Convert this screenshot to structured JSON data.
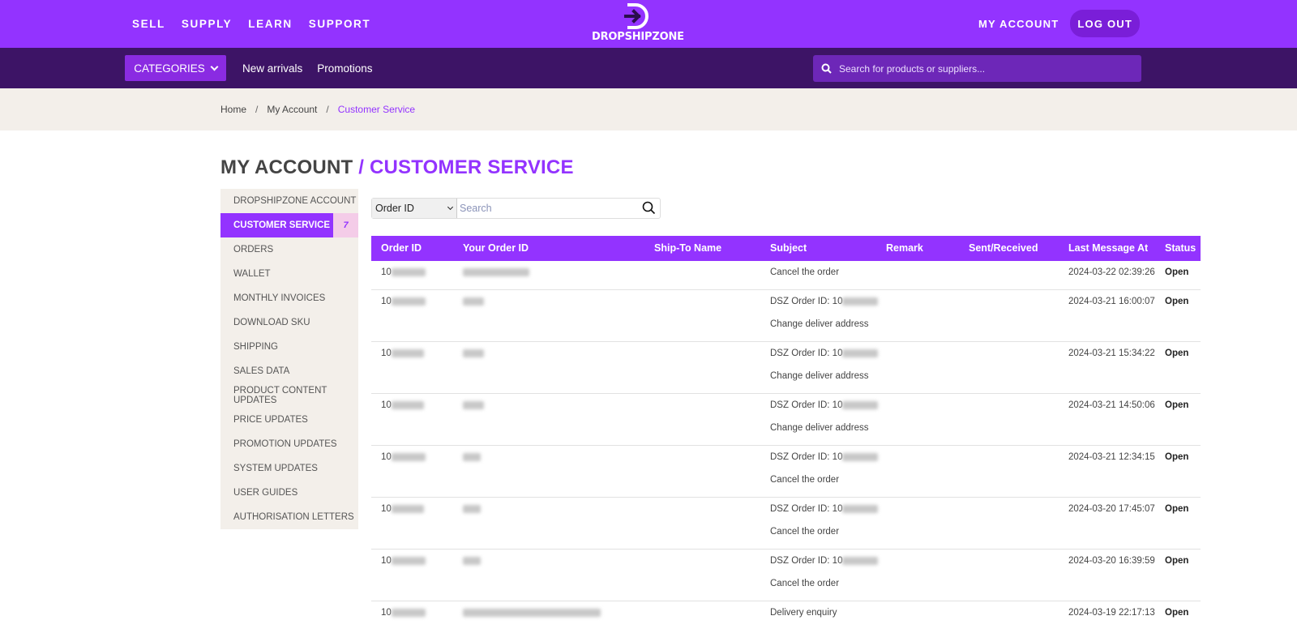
{
  "topnav": {
    "items": [
      "SELL",
      "SUPPLY",
      "LEARN",
      "SUPPORT"
    ],
    "brand": "DROPSHIPZONE",
    "my_account": "MY ACCOUNT",
    "logout": "LOG OUT"
  },
  "subnav": {
    "categories": "CATEGORIES",
    "new_arrivals": "New arrivals",
    "promotions": "Promotions",
    "search_placeholder": "Search for products or suppliers..."
  },
  "breadcrumb": {
    "home": "Home",
    "sep": "/",
    "my_account": "My Account",
    "current": "Customer Service"
  },
  "title": {
    "part1": "MY ACCOUNT",
    "part2": "/ CUSTOMER SERVICE"
  },
  "sidebar": {
    "items": [
      "DROPSHIPZONE ACCOUNT",
      "CUSTOMER SERVICE",
      "ORDERS",
      "WALLET",
      "MONTHLY INVOICES",
      "DOWNLOAD SKU",
      "SHIPPING",
      "SALES DATA",
      "PRODUCT CONTENT UPDATES",
      "PRICE UPDATES",
      "PROMOTION UPDATES",
      "SYSTEM UPDATES",
      "USER GUIDES",
      "AUTHORISATION LETTERS"
    ],
    "active_badge": "7"
  },
  "filter": {
    "select_value": "Order ID",
    "search_placeholder": "Search"
  },
  "table": {
    "headers": [
      "Order ID",
      "Your Order ID",
      "Ship-To Name",
      "Subject",
      "Remark",
      "Sent/Received",
      "Last Message At",
      "Status"
    ],
    "rows": [
      {
        "order_prefix": "10",
        "subject1": "Cancel the order",
        "subject2": "",
        "last": "2024-03-22 02:39:26",
        "status": "Open"
      },
      {
        "order_prefix": "10",
        "subject1": "DSZ Order ID: 10",
        "subject2": "Change deliver address",
        "last": "2024-03-21 16:00:07",
        "status": "Open"
      },
      {
        "order_prefix": "10",
        "subject1": "DSZ Order ID: 10",
        "subject2": "Change deliver address",
        "last": "2024-03-21 15:34:22",
        "status": "Open"
      },
      {
        "order_prefix": "10",
        "subject1": "DSZ Order ID: 10",
        "subject2": "Change deliver address",
        "last": "2024-03-21 14:50:06",
        "status": "Open"
      },
      {
        "order_prefix": "10",
        "subject1": "DSZ Order ID: 10",
        "subject2": "Cancel the order",
        "last": "2024-03-21 12:34:15",
        "status": "Open"
      },
      {
        "order_prefix": "10",
        "subject1": "DSZ Order ID: 10",
        "subject2": "Cancel the order",
        "last": "2024-03-20 17:45:07",
        "status": "Open"
      },
      {
        "order_prefix": "10",
        "subject1": "DSZ Order ID: 10",
        "subject2": "Cancel the order",
        "last": "2024-03-20 16:39:59",
        "status": "Open"
      },
      {
        "order_prefix": "10",
        "subject1": "Delivery enquiry",
        "subject2": "",
        "last": "2024-03-19 22:17:13",
        "status": "Open"
      }
    ]
  },
  "colors": {
    "brand": "#9333ff",
    "subnav": "#3d1466",
    "crumb_bg": "#f3efea"
  }
}
